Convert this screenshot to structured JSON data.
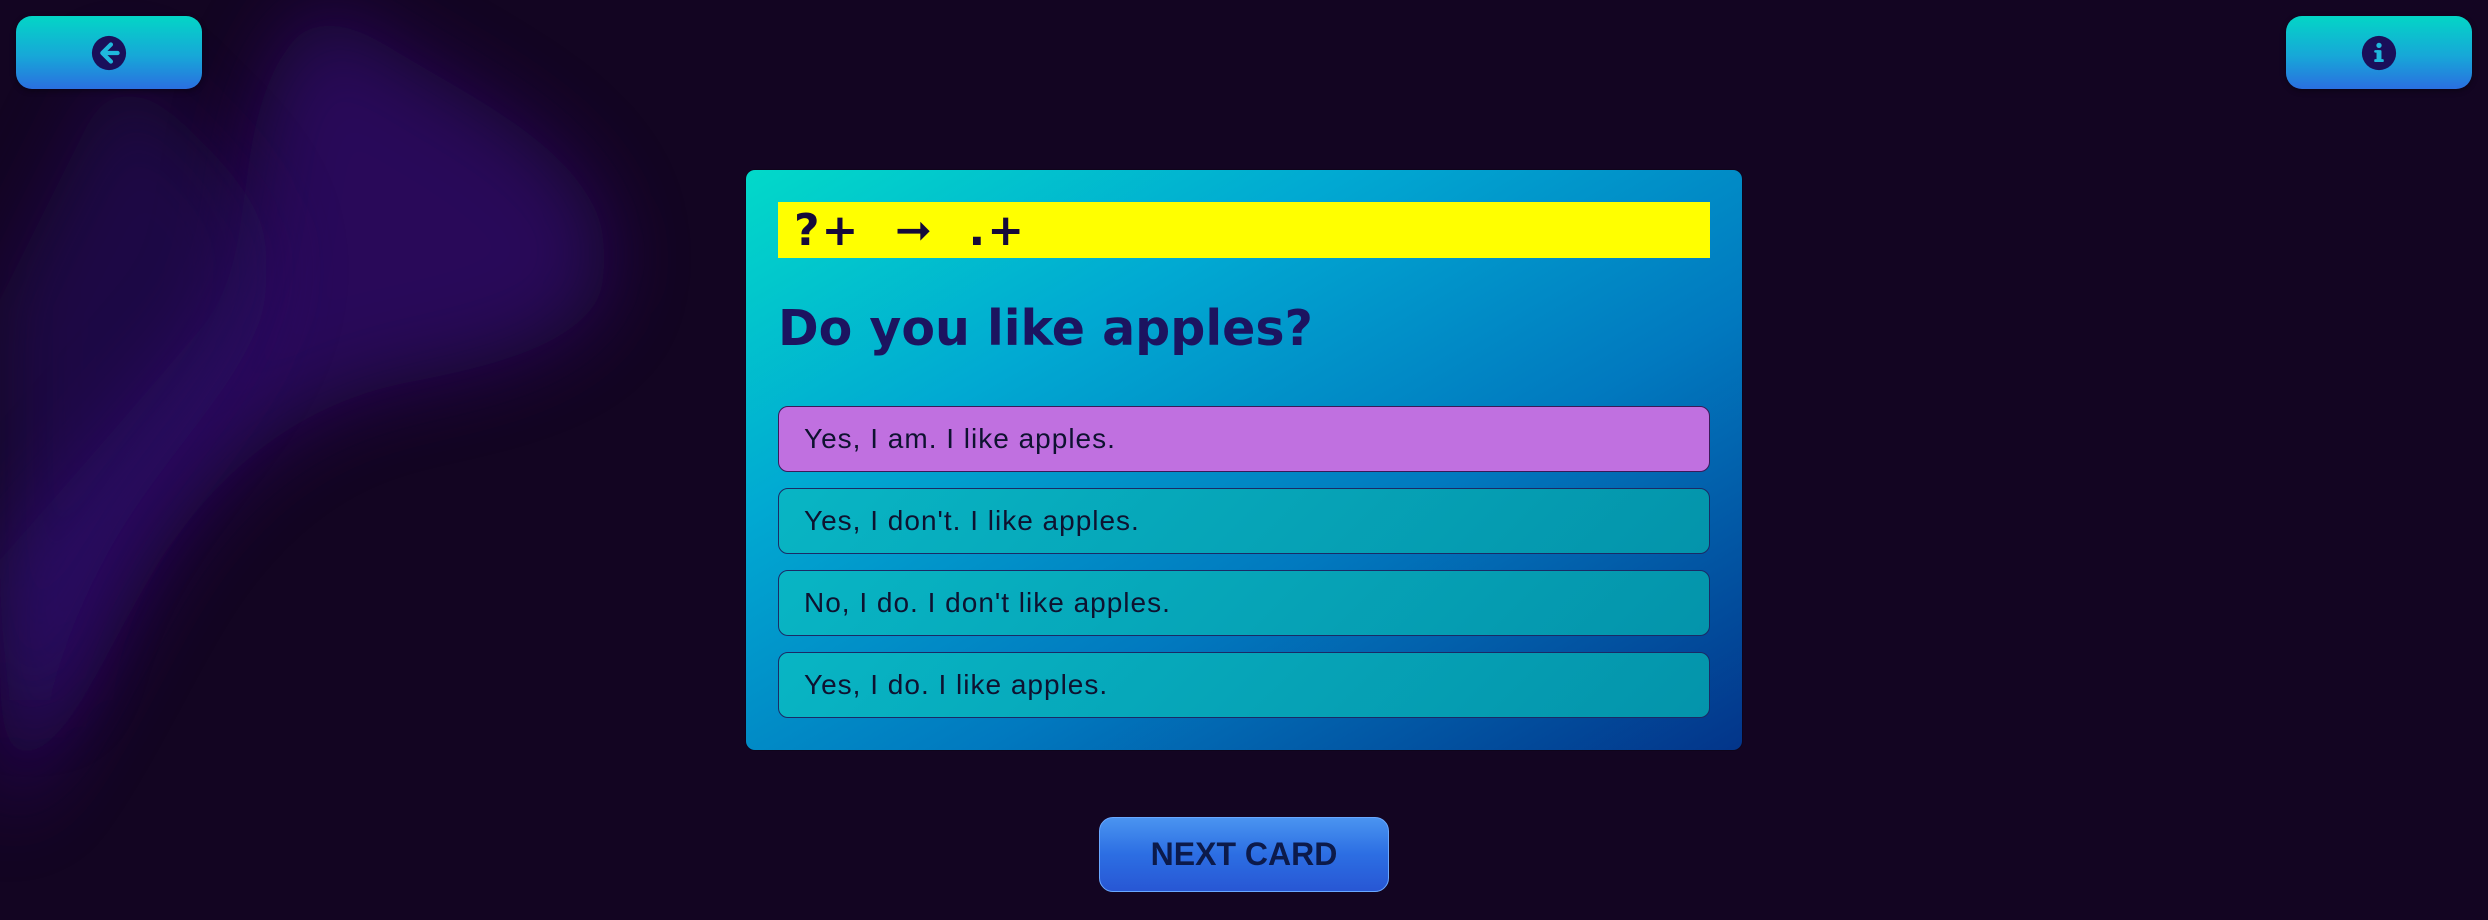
{
  "nav": {
    "back_icon": "arrow-left-circle-icon",
    "info_icon": "info-circle-icon"
  },
  "card": {
    "banner_text": "?+  ➞  .+",
    "question": "Do you like apples?",
    "answers": [
      {
        "label": "Yes, I am. I like apples.",
        "selected": true
      },
      {
        "label": "Yes, I don't. I like apples.",
        "selected": false
      },
      {
        "label": "No, I do. I don't like apples.",
        "selected": false
      },
      {
        "label": "Yes, I do. I like apples.",
        "selected": false
      }
    ]
  },
  "footer": {
    "next_label": "NEXT CARD"
  },
  "colors": {
    "background": "#130522",
    "banner": "#ffff00",
    "selected_answer": "#c070e0",
    "answer": "#08b5c4",
    "accent": "#02d9c9"
  }
}
